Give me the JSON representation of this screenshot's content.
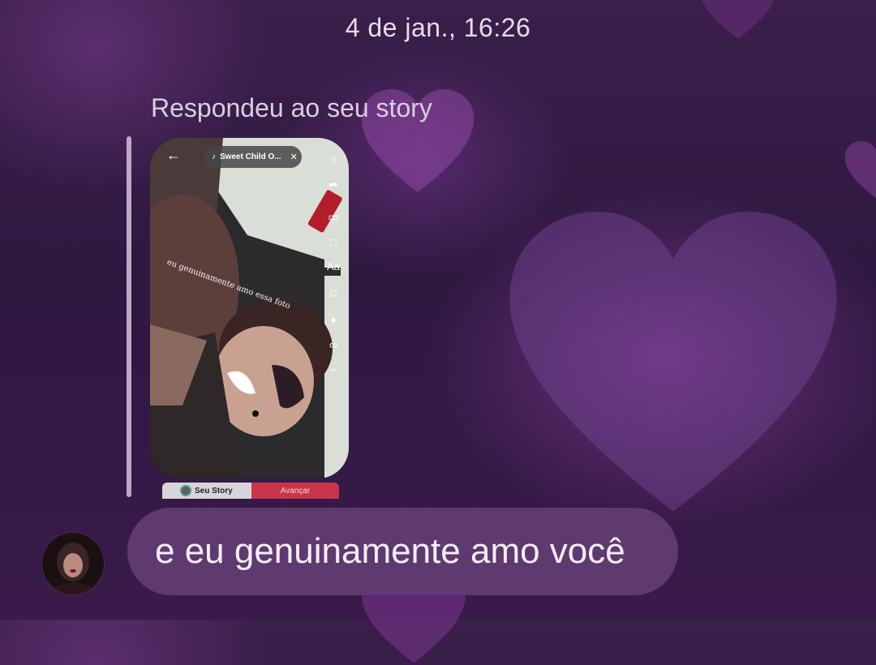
{
  "chat": {
    "timestamp": "4 de jan., 16:26",
    "reply_label": "Respondeu ao seu story",
    "message_text": "e eu genuinamente amo você"
  },
  "story_preview": {
    "music_title": "Sweet Child O...",
    "caption": "eu genuinamente amo essa foto",
    "footer_left_label": "Seu Story",
    "footer_right_label": "Avançar",
    "tools": [
      "Aa"
    ],
    "icons": [
      "back-arrow-icon",
      "music-note-icon",
      "close-icon",
      "settings-icon",
      "share-icon",
      "frame-icon",
      "sticker-icon",
      "text-icon",
      "emoji-icon",
      "sparkle-icon",
      "effects-icon",
      "chevron-down-icon"
    ]
  },
  "colors": {
    "bubble": "#5e3a70",
    "reply_bar": "#b9abc3",
    "advance_button": "#c8354a"
  }
}
